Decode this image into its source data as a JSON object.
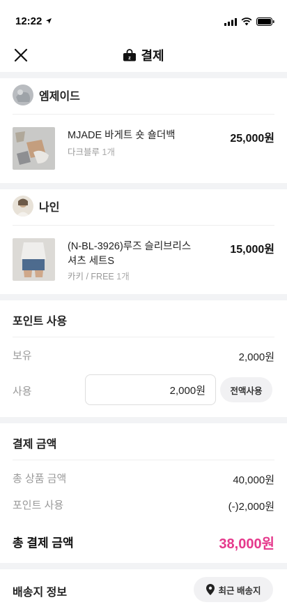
{
  "status_bar": {
    "time": "12:22",
    "icons": [
      "location-arrow-icon",
      "signal-icon",
      "wifi-icon",
      "battery-icon"
    ]
  },
  "header": {
    "title": "결제",
    "icons": [
      "close-icon",
      "shopping-bag-icon"
    ]
  },
  "shops": [
    {
      "name": "엠제이드",
      "items": [
        {
          "name": "MJADE 바게트 숏 숄더백",
          "option": "다크블루",
          "qty": "1개",
          "price": "25,000원"
        }
      ]
    },
    {
      "name": "나인",
      "items": [
        {
          "name": "(N-BL-3926)루즈 슬리브리스 셔츠 세트S",
          "option": "카키 / FREE",
          "qty": "1개",
          "price": "15,000원"
        }
      ]
    }
  ],
  "points": {
    "title": "포인트 사용",
    "owned_label": "보유",
    "owned_value": "2,000원",
    "use_label": "사용",
    "use_value": "2,000원",
    "use_all_label": "전액사용"
  },
  "payment": {
    "title": "결제 금액",
    "subtotal_label": "총 상품 금액",
    "subtotal_value": "40,000원",
    "points_label": "포인트 사용",
    "points_value": "(-)2,000원",
    "total_label": "총 결제 금액",
    "total_value": "38,000원"
  },
  "shipping": {
    "title": "배송지 정보",
    "recent_label": "최근 배송지",
    "icon": "map-pin-icon"
  },
  "colors": {
    "accent": "#e5398c",
    "divider": "#f2f3f5",
    "muted_text": "#999999"
  }
}
